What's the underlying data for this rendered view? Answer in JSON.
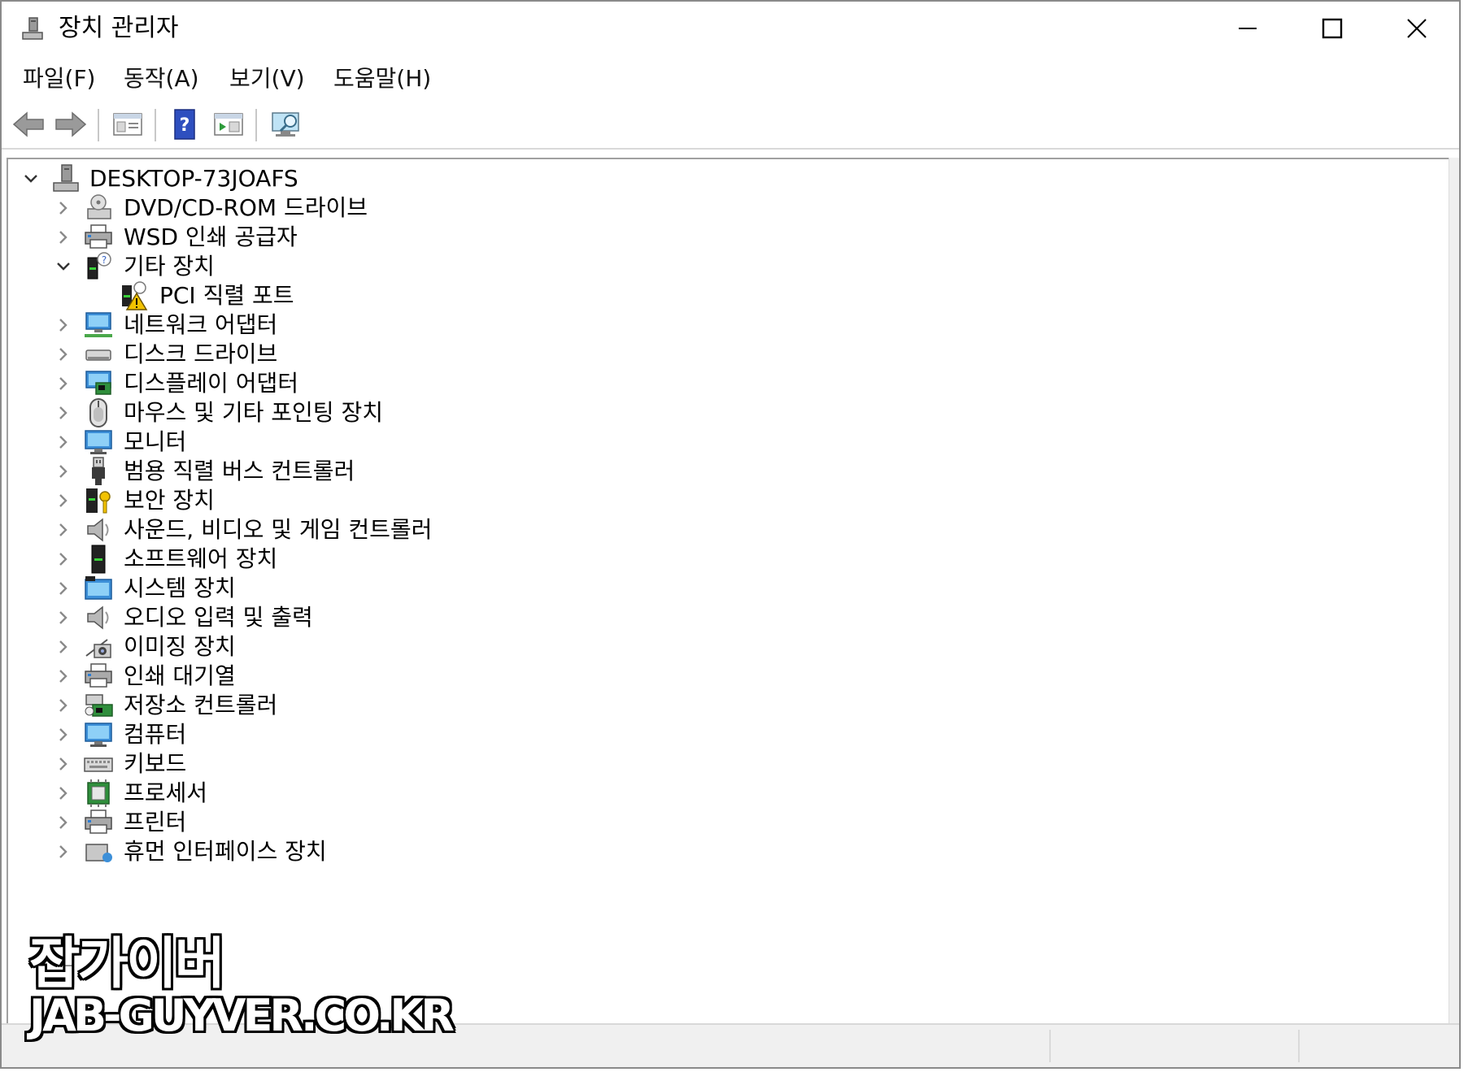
{
  "window": {
    "title": "장치 관리자",
    "computer_icon": "computer-icon"
  },
  "controls": {
    "minimize_icon": "minimize-icon",
    "maximize_icon": "maximize-icon",
    "close_icon": "close-icon"
  },
  "menu": [
    {
      "label": "파일(F)"
    },
    {
      "label": "동작(A)"
    },
    {
      "label": "보기(V)"
    },
    {
      "label": "도움말(H)"
    }
  ],
  "toolbar": [
    {
      "icon": "back-arrow-icon"
    },
    {
      "icon": "forward-arrow-icon"
    },
    {
      "icon": "properties-icon"
    },
    {
      "icon": "help-icon"
    },
    {
      "icon": "update-driver-icon"
    },
    {
      "icon": "scan-hardware-icon"
    }
  ],
  "tree": {
    "root": {
      "label": "DESKTOP-73JOAFS",
      "expanded": true,
      "icon": "computer-icon"
    },
    "items": [
      {
        "label": "DVD/CD-ROM 드라이브",
        "icon": "dvd-drive-icon",
        "expanded": false
      },
      {
        "label": "WSD 인쇄 공급자",
        "icon": "printer-icon",
        "expanded": false
      },
      {
        "label": "기타 장치",
        "icon": "unknown-device-icon",
        "expanded": true
      },
      {
        "label": "PCI 직렬 포트",
        "icon": "warning-device-icon",
        "child": true
      },
      {
        "label": "네트워크 어댑터",
        "icon": "network-adapter-icon",
        "expanded": false
      },
      {
        "label": "디스크 드라이브",
        "icon": "disk-drive-icon",
        "expanded": false
      },
      {
        "label": "디스플레이 어댑터",
        "icon": "display-adapter-icon",
        "expanded": false
      },
      {
        "label": "마우스 및 기타 포인팅 장치",
        "icon": "mouse-icon",
        "expanded": false
      },
      {
        "label": "모니터",
        "icon": "monitor-icon",
        "expanded": false
      },
      {
        "label": "범용 직렬 버스 컨트롤러",
        "icon": "usb-icon",
        "expanded": false
      },
      {
        "label": "보안 장치",
        "icon": "security-key-icon",
        "expanded": false
      },
      {
        "label": "사운드, 비디오 및 게임 컨트롤러",
        "icon": "speaker-icon",
        "expanded": false
      },
      {
        "label": "소프트웨어 장치",
        "icon": "software-device-icon",
        "expanded": false
      },
      {
        "label": "시스템 장치",
        "icon": "system-folder-icon",
        "expanded": false
      },
      {
        "label": "오디오 입력 및 출력",
        "icon": "speaker-icon",
        "expanded": false
      },
      {
        "label": "이미징 장치",
        "icon": "camera-icon",
        "expanded": false
      },
      {
        "label": "인쇄 대기열",
        "icon": "printer-icon",
        "expanded": false
      },
      {
        "label": "저장소 컨트롤러",
        "icon": "storage-controller-icon",
        "expanded": false
      },
      {
        "label": "컴퓨터",
        "icon": "monitor-icon",
        "expanded": false
      },
      {
        "label": "키보드",
        "icon": "keyboard-icon",
        "expanded": false
      },
      {
        "label": "프로세서",
        "icon": "processor-icon",
        "expanded": false
      },
      {
        "label": "프린터",
        "icon": "printer-icon",
        "expanded": false
      },
      {
        "label": "휴먼 인터페이스 장치",
        "icon": "hid-icon",
        "expanded": false
      }
    ]
  },
  "watermark": {
    "korean": "잡가이버",
    "url": "JAB-GUYVER.CO.KR"
  }
}
